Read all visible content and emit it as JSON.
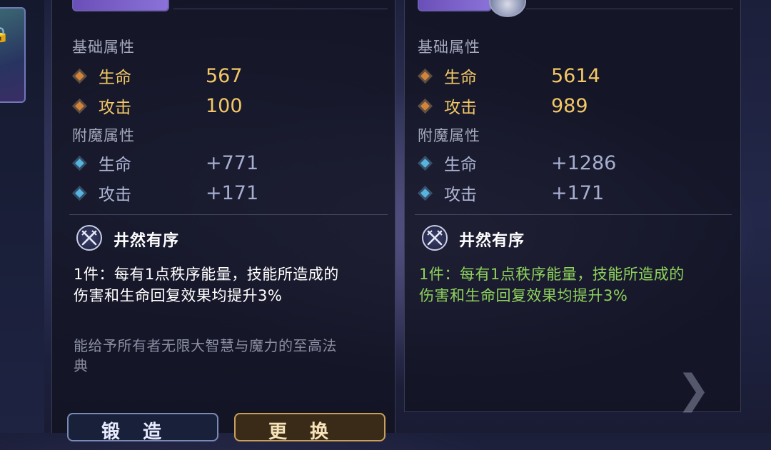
{
  "left": {
    "base_title": "基础属性",
    "base_stats": [
      {
        "name": "生命",
        "value": "567"
      },
      {
        "name": "攻击",
        "value": "100"
      }
    ],
    "enchant_title": "附魔属性",
    "enchant_stats": [
      {
        "name": "生命",
        "value": "+771"
      },
      {
        "name": "攻击",
        "value": "+171"
      }
    ],
    "set_name": "井然有序",
    "set_desc_line1": "1件：每有1点秩序能量，技能所造成的",
    "set_desc_line2": "伤害和生命回复效果均提升3%",
    "flavor_line1": "能给予所有者无限大智慧与魔力的至高法",
    "flavor_line2": "典",
    "buttons": {
      "upgrade": "锻造",
      "replace": "更换"
    }
  },
  "right": {
    "base_title": "基础属性",
    "base_stats": [
      {
        "name": "生命",
        "value": "5614"
      },
      {
        "name": "攻击",
        "value": "989"
      }
    ],
    "enchant_title": "附魔属性",
    "enchant_stats": [
      {
        "name": "生命",
        "value": "+1286"
      },
      {
        "name": "攻击",
        "value": "+171"
      }
    ],
    "set_name": "井然有序",
    "set_desc_line1": "1件：每有1点秩序能量，技能所造成的",
    "set_desc_line2": "伤害和生命回复效果均提升3%"
  },
  "icons": {
    "lock": "lock-icon",
    "set": "crossed-swords-icon",
    "next": "chevron-right-icon"
  },
  "colors": {
    "gold": "#f3c766",
    "blue_stat": "#aeb6d4",
    "active_set_green": "#8ed25c"
  }
}
